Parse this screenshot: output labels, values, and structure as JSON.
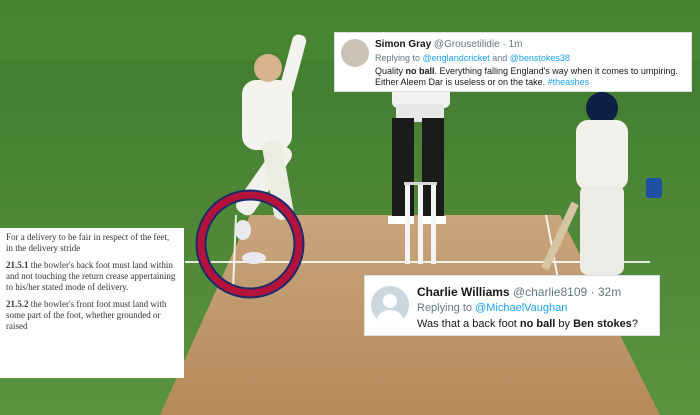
{
  "colors": {
    "accent": "#1da1f2",
    "circle": "#b3123a",
    "circle_outer": "#1a2a6b"
  },
  "tweet1": {
    "name": "Simon Gray",
    "handle": "@Grousetilidie",
    "dot": "·",
    "time": "1m",
    "replying_prefix": "Replying to ",
    "replying_to_1": "@englandcricket",
    "replying_and": " and ",
    "replying_to_2": "@benstokes38",
    "body_1": "Quality ",
    "body_bold": "no ball",
    "body_2": ".  Everything falling England's way when it comes to umpiring. Either Aleem Dar is useless or on the take. ",
    "hashtag": "#theashes"
  },
  "tweet2": {
    "name": "Charlie Williams",
    "handle": "@charlie8109",
    "dot": "·",
    "time": "32m",
    "replying_prefix": "Replying to ",
    "replying_to": "@MichaelVaughan",
    "body_1": "Was that a back foot ",
    "body_bold_1": "no ball",
    "body_2": " by ",
    "body_bold_2": "Ben stokes",
    "body_3": "?"
  },
  "rules": {
    "intro": "For a delivery to be fair in respect of the feet, in the delivery stride",
    "r1_num": "21.5.1",
    "r1_text": " the bowler's back foot must land within and not touching the return crease appertaining to his/her stated mode of delivery.",
    "r2_num": "21.5.2",
    "r2_text": " the bowler's front foot must land with some part of the foot, whether grounded or raised"
  }
}
